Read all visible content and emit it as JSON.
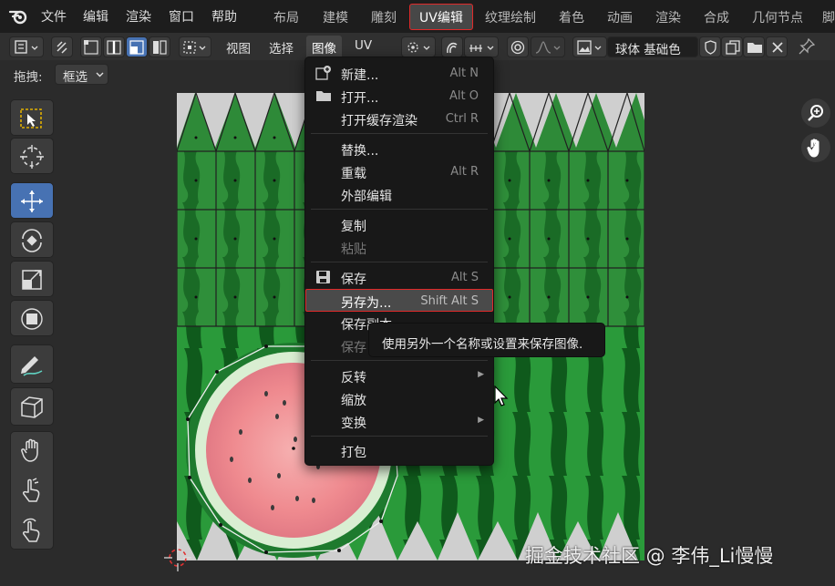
{
  "top_menu": [
    "文件",
    "编辑",
    "渲染",
    "窗口",
    "帮助"
  ],
  "workspaces": [
    "布局",
    "建模",
    "雕刻",
    "UV编辑",
    "纹理绘制",
    "着色",
    "动画",
    "渲染",
    "合成",
    "几何节点",
    "脚"
  ],
  "active_workspace": "UV编辑",
  "header": {
    "view": "视图",
    "select": "选择",
    "image": "图像",
    "uv": "UV",
    "image_name": "球体 基础色"
  },
  "drag": {
    "label": "拖拽:",
    "value": "框选"
  },
  "menu": {
    "new": {
      "label": "新建...",
      "shortcut": "Alt N"
    },
    "open": {
      "label": "打开...",
      "shortcut": "Alt O"
    },
    "open_cache": {
      "label": "打开缓存渲染",
      "shortcut": "Ctrl R"
    },
    "replace": {
      "label": "替换..."
    },
    "reload": {
      "label": "重载",
      "shortcut": "Alt R"
    },
    "edit_external": {
      "label": "外部编辑"
    },
    "copy": {
      "label": "复制"
    },
    "paste": {
      "label": "粘贴"
    },
    "save": {
      "label": "保存",
      "shortcut": "Alt S"
    },
    "save_as": {
      "label": "另存为...",
      "shortcut": "Shift Alt S"
    },
    "save_copy": {
      "label": "保存副本"
    },
    "save_all": {
      "label": "保存"
    },
    "invert": {
      "label": "反转"
    },
    "resize": {
      "label": "缩放"
    },
    "transform": {
      "label": "变换"
    },
    "pack": {
      "label": "打包"
    }
  },
  "tooltip": "使用另外一个名称或设置来保存图像.",
  "watermark": "掘金技术社区 @ 李伟_Li慢慢",
  "colors": {
    "accent_blue": "#4772b3",
    "highlight_red": "#e02a2a",
    "menu_bg": "#181818"
  }
}
